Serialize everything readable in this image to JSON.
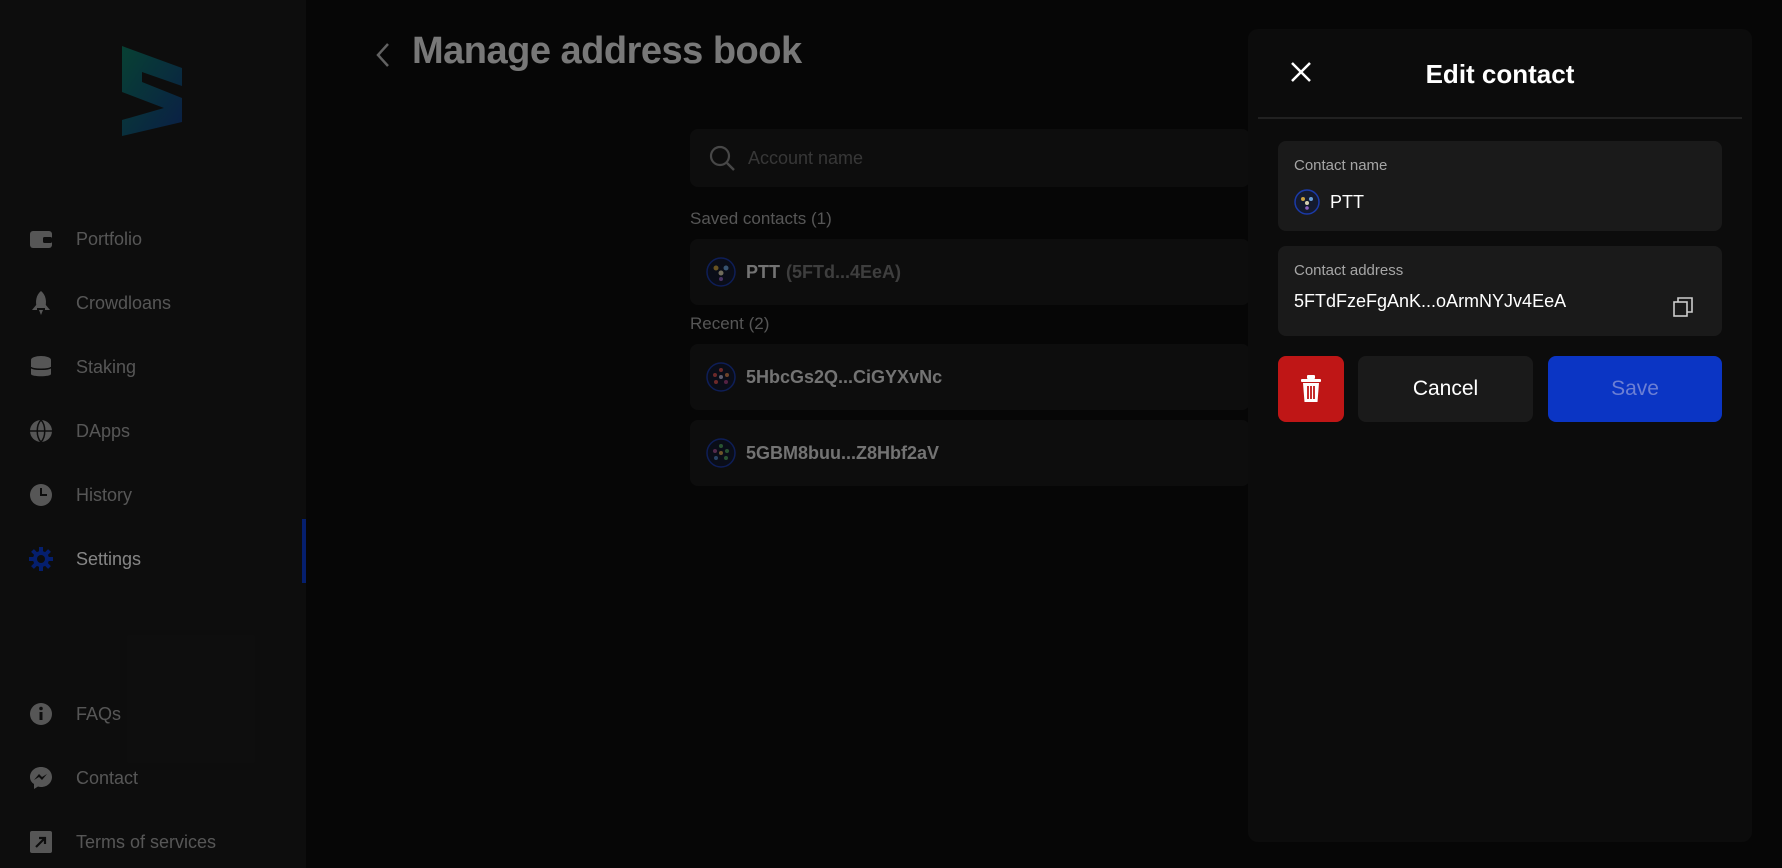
{
  "sidebar": {
    "items": [
      {
        "label": "Portfolio",
        "icon": "wallet-icon"
      },
      {
        "label": "Crowdloans",
        "icon": "rocket-icon"
      },
      {
        "label": "Staking",
        "icon": "database-icon"
      },
      {
        "label": "DApps",
        "icon": "globe-icon"
      },
      {
        "label": "History",
        "icon": "clock-icon"
      },
      {
        "label": "Settings",
        "icon": "gear-icon",
        "active": true
      }
    ],
    "footer_items": [
      {
        "label": "FAQs",
        "icon": "info-icon"
      },
      {
        "label": "Contact",
        "icon": "messenger-icon"
      },
      {
        "label": "Terms of services",
        "icon": "external-link-icon"
      }
    ]
  },
  "main": {
    "title": "Manage address book",
    "search": {
      "placeholder": "Account name"
    },
    "saved_label": "Saved contacts (1)",
    "saved": [
      {
        "name": "PTT",
        "address": "(5FTd...4EeA)"
      }
    ],
    "recent_label": "Recent (2)",
    "recent": [
      {
        "address": "5HbcGs2Q...CiGYXvNc"
      },
      {
        "address": "5GBM8buu...Z8Hbf2aV"
      }
    ]
  },
  "modal": {
    "title": "Edit contact",
    "name_label": "Contact name",
    "name_value": "PTT",
    "address_label": "Contact address",
    "address_value": "5FTdFzeFgAnK...oArmNYJv4EeA",
    "cancel_label": "Cancel",
    "save_label": "Save"
  },
  "colors": {
    "accent": "#0b35c4",
    "danger": "#bf1616",
    "sidebar_bg": "#1a1a1a",
    "panel_bg": "#0c0c0c"
  }
}
